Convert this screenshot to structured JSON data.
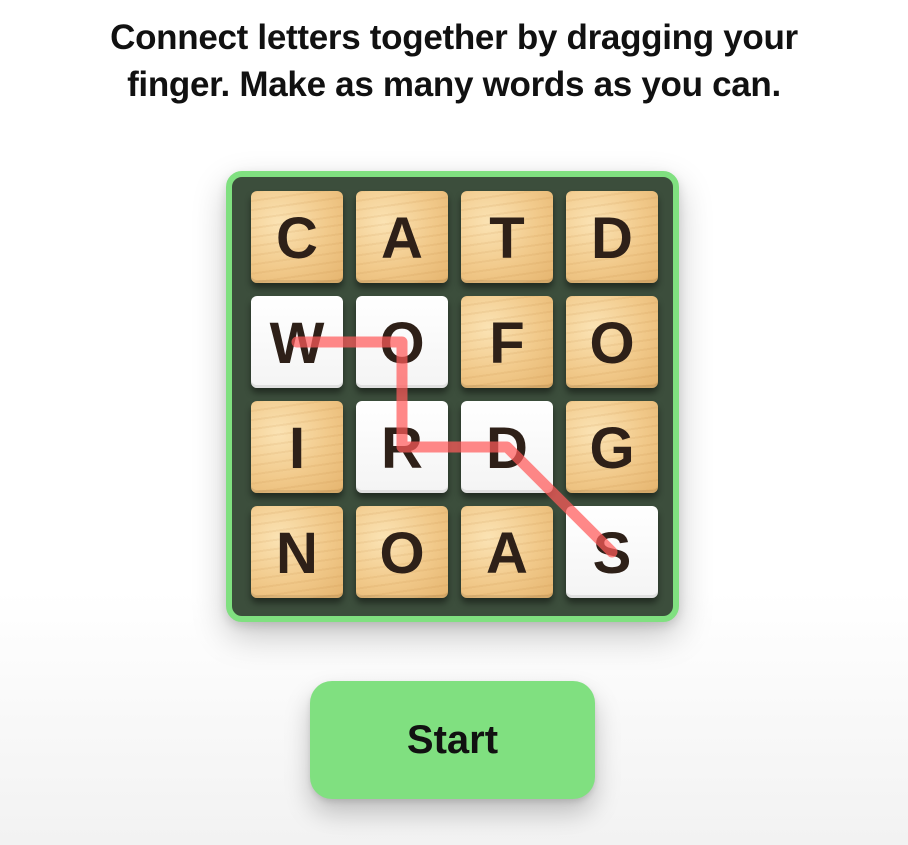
{
  "instructions": {
    "line1": "Connect letters together by dragging your",
    "line2": "finger. Make as many words as you can."
  },
  "board": {
    "rows": [
      [
        "C",
        "A",
        "T",
        "D"
      ],
      [
        "W",
        "O",
        "F",
        "O"
      ],
      [
        "I",
        "R",
        "D",
        "G"
      ],
      [
        "N",
        "O",
        "A",
        "S"
      ]
    ],
    "selected_path": [
      [
        1,
        0
      ],
      [
        1,
        1
      ],
      [
        2,
        1
      ],
      [
        2,
        2
      ],
      [
        3,
        3
      ]
    ]
  },
  "start_button": {
    "label": "Start"
  },
  "colors": {
    "board_border": "#80e080",
    "board_fill": "#3c4e3c",
    "path_line": "#ff5a5a",
    "button": "#80e080"
  }
}
